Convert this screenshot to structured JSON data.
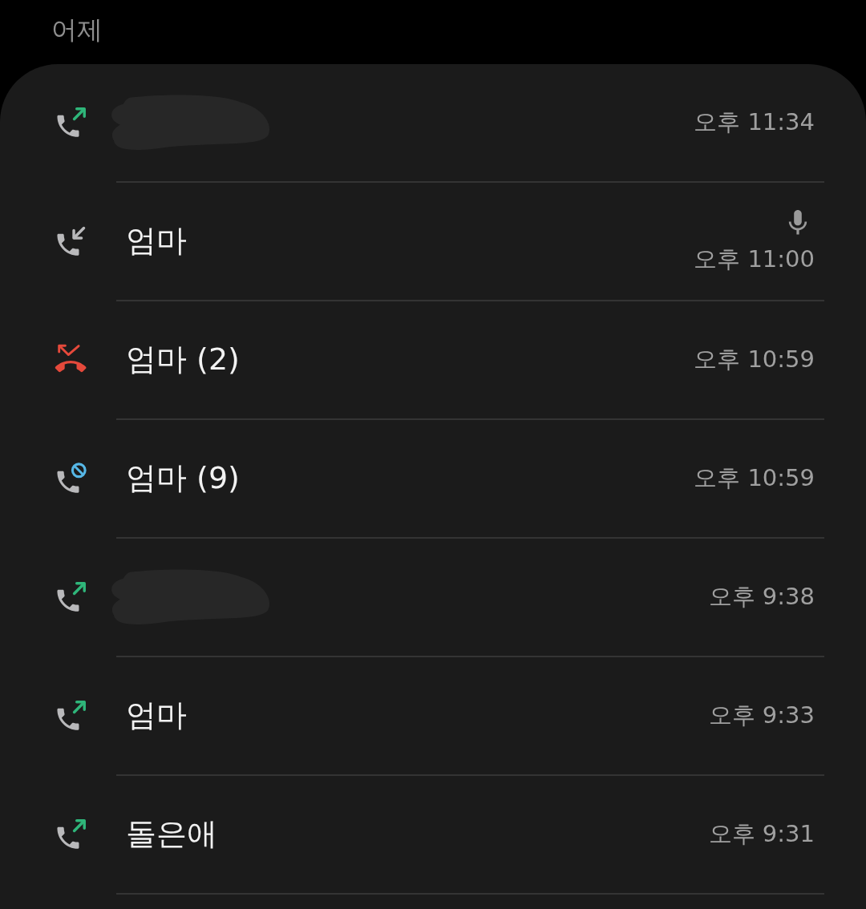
{
  "section_header": "어제",
  "rows": [
    {
      "kind": "outgoing",
      "redacted": true,
      "recorded": false,
      "time": "오후 11:34"
    },
    {
      "kind": "incoming",
      "redacted": false,
      "name": "엄마",
      "recorded": true,
      "time": "오후 11:00"
    },
    {
      "kind": "missed",
      "redacted": false,
      "name": "엄마 (2)",
      "recorded": false,
      "time": "오후 10:59"
    },
    {
      "kind": "rejected",
      "redacted": false,
      "name": "엄마 (9)",
      "recorded": false,
      "time": "오후 10:59"
    },
    {
      "kind": "outgoing",
      "redacted": true,
      "recorded": false,
      "time": "오후 9:38"
    },
    {
      "kind": "outgoing",
      "redacted": false,
      "name": "엄마",
      "recorded": false,
      "time": "오후 9:33"
    },
    {
      "kind": "outgoing",
      "redacted": false,
      "name": "돌은애",
      "recorded": false,
      "time": "오후 9:31"
    }
  ]
}
